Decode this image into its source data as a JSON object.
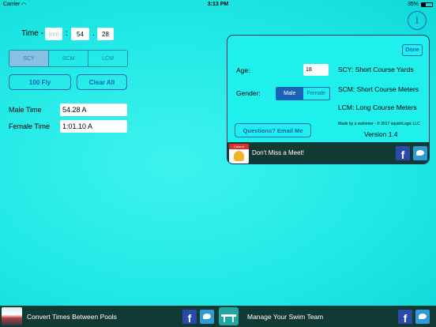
{
  "status_bar": {
    "carrier": "Carrier",
    "wifi_icon": "wifi-icon",
    "time": "3:13 PM",
    "battery": "35%"
  },
  "time_entry": {
    "label": "Time -",
    "minutes_placeholder": "mm",
    "seconds": "54",
    "hundredths": "28",
    "sep1": ":",
    "sep2": "."
  },
  "course_tabs": {
    "items": [
      "SCY",
      "SCM",
      "LCM"
    ],
    "selected": "SCY"
  },
  "buttons": {
    "event": "100 Fly",
    "clear": "Clear All"
  },
  "results": [
    {
      "label": "Male Time",
      "value": "54.28 A"
    },
    {
      "label": "Female Time",
      "value": "1:01.10 A"
    }
  ],
  "info_button": {
    "glyph": "i"
  },
  "popover": {
    "done": "Done",
    "age_label": "Age:",
    "age_value": "18",
    "gender_label": "Gender:",
    "gender_options": [
      "Male",
      "Female"
    ],
    "gender_selected": "Male",
    "courses": [
      "SCY: Short Course Yards",
      "SCM: Short Course Meters",
      "LCM: Long Course Meters"
    ],
    "email_button": "Questions? Email Me",
    "credit": "Made by a swimmer - © 2017 squishLogic LLC",
    "version": "Version 1.4",
    "banner": {
      "icon_label": "Calarm",
      "text": "Don't Miss a Meet!"
    }
  },
  "bottom_bar": {
    "left_text": "Convert Times Between Pools",
    "right_text": "Manage Your Swim Team",
    "facebook_glyph": "f"
  },
  "colors": {
    "background": "#22e9e6",
    "accent": "#1c62b8",
    "banner": "#123a34"
  }
}
